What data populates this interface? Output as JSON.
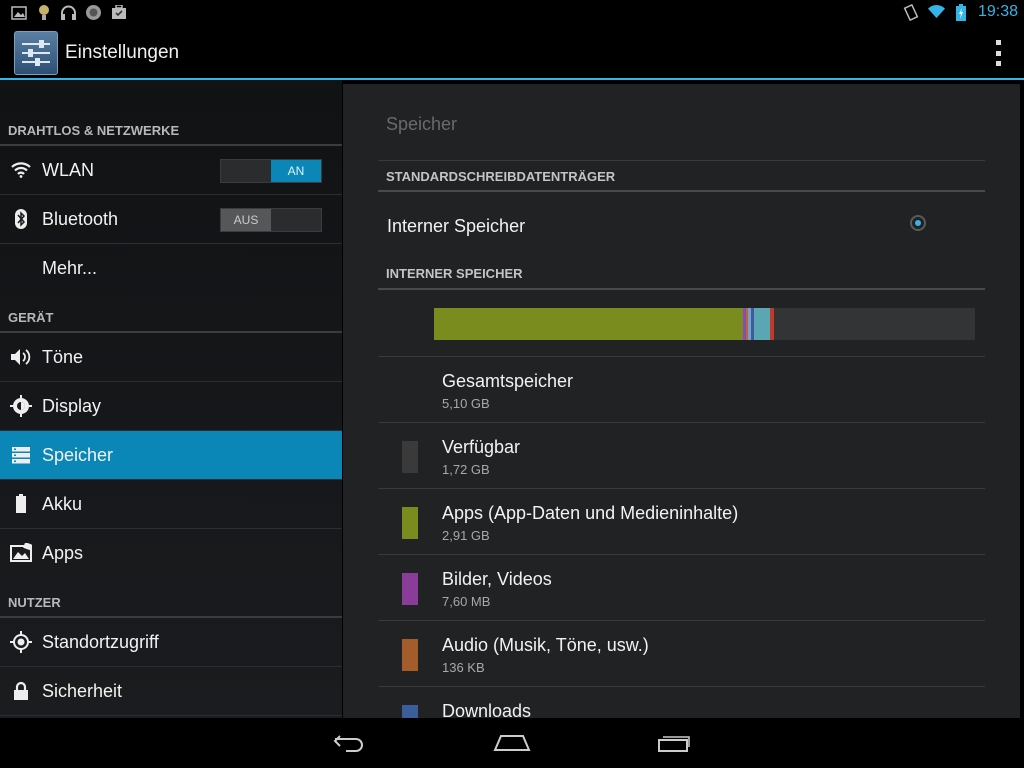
{
  "status_bar": {
    "left_icons": [
      "image-notification-icon",
      "bulb-notification-icon",
      "headset-notification-icon",
      "app-notification-icon",
      "briefcase-notification-icon"
    ],
    "right_icons": [
      "rotate-lock-icon",
      "wifi-signal-icon",
      "battery-charging-icon"
    ],
    "time": "19:38"
  },
  "action_bar": {
    "title": "Einstellungen"
  },
  "sidebar": {
    "sections": [
      {
        "header": "DRAHTLOS & NETZWERKE",
        "items": [
          {
            "label": "WLAN",
            "icon": "wifi-icon",
            "toggle": "AN",
            "toggle_on": true
          },
          {
            "label": "Bluetooth",
            "icon": "bluetooth-icon",
            "toggle": "AUS",
            "toggle_on": false
          },
          {
            "label": "Mehr...",
            "icon": ""
          }
        ]
      },
      {
        "header": "GERÄT",
        "items": [
          {
            "label": "Töne",
            "icon": "speaker-icon"
          },
          {
            "label": "Display",
            "icon": "brightness-icon"
          },
          {
            "label": "Speicher",
            "icon": "storage-icon",
            "selected": true
          },
          {
            "label": "Akku",
            "icon": "battery-icon"
          },
          {
            "label": "Apps",
            "icon": "apps-icon"
          }
        ]
      },
      {
        "header": "NUTZER",
        "items": [
          {
            "label": "Standortzugriff",
            "icon": "location-icon"
          },
          {
            "label": "Sicherheit",
            "icon": "lock-icon"
          }
        ]
      }
    ]
  },
  "storage": {
    "title": "Speicher",
    "default_header": "STANDARDSCHREIBDATENTRÄGER",
    "default_option": "Interner Speicher",
    "default_selected": true,
    "internal_header": "INTERNER SPEICHER",
    "usage_bar": [
      {
        "color": "#7a8c1e",
        "fraction": 0.571
      },
      {
        "color": "#8a4cae",
        "fraction": 0.006
      },
      {
        "color": "#b7653a",
        "fraction": 0.004
      },
      {
        "color": "#7aa0d0",
        "fraction": 0.005
      },
      {
        "color": "#3b5e9a",
        "fraction": 0.006
      },
      {
        "color": "#5aa7b3",
        "fraction": 0.03
      },
      {
        "color": "#c0392b",
        "fraction": 0.008
      }
    ],
    "rows": [
      {
        "name": "Gesamtspeicher",
        "value": "5,10 GB",
        "color": ""
      },
      {
        "name": "Verfügbar",
        "value": "1,72 GB",
        "color": "#3a3a3a"
      },
      {
        "name": "Apps (App-Daten und Medieninhalte)",
        "value": "2,91 GB",
        "color": "#7a8c1e"
      },
      {
        "name": "Bilder, Videos",
        "value": "7,60 MB",
        "color": "#8a3d98"
      },
      {
        "name": "Audio (Musik, Töne, usw.)",
        "value": "136 KB",
        "color": "#a35c2a"
      },
      {
        "name": "Downloads",
        "value": "",
        "color": "#3b5e9a"
      }
    ]
  },
  "nav_bar": {
    "buttons": [
      "back-icon",
      "home-icon",
      "recent-apps-icon"
    ]
  }
}
